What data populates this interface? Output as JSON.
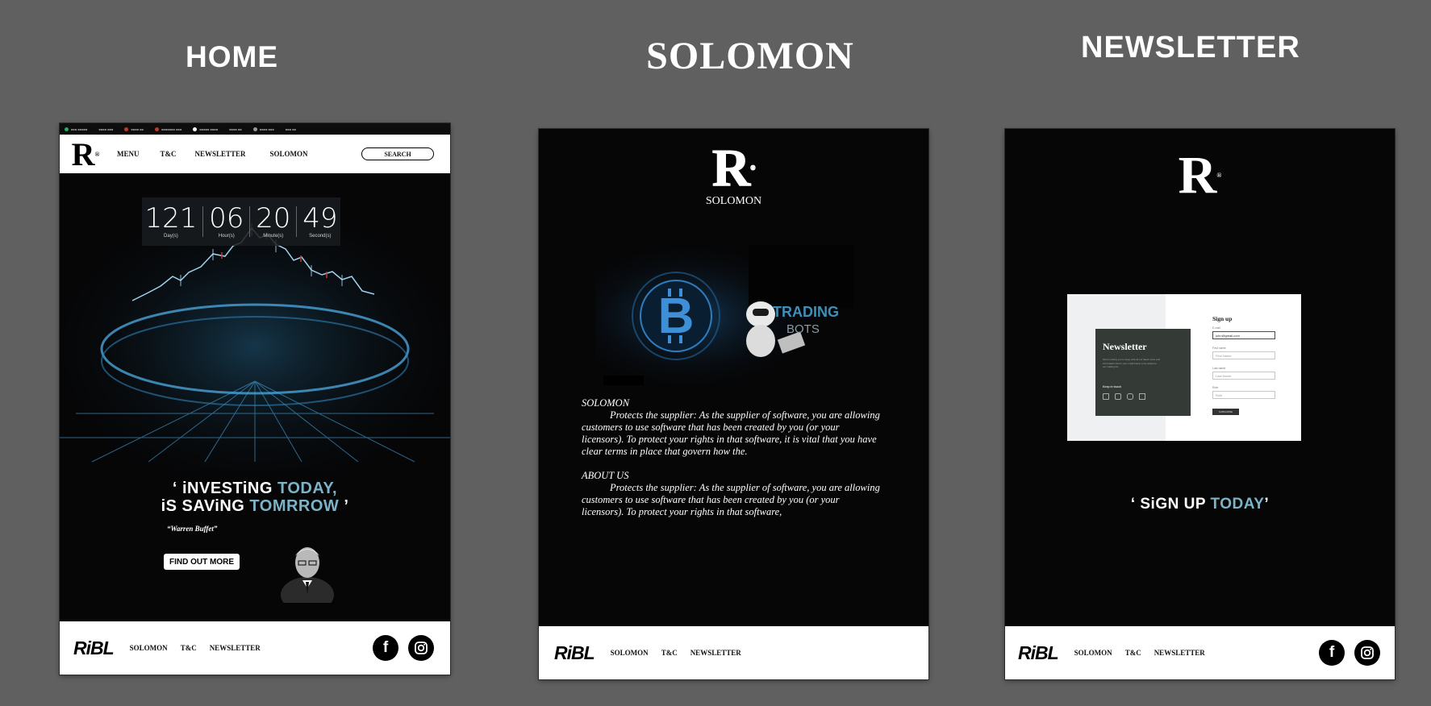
{
  "boards": [
    {
      "title": "HOME"
    },
    {
      "title": "SOLOMON"
    },
    {
      "title": "NEWSLETTER"
    }
  ],
  "home": {
    "nav": {
      "menu": "MENU",
      "tc": "T&C",
      "newsletter": "NEWSLETTER",
      "solomon": "SOLOMON",
      "search": "SEARCH"
    },
    "countdown": {
      "days": "121",
      "days_label": "Day(s)",
      "hours": "06",
      "hours_label": "Hour(s)",
      "minutes": "20",
      "minutes_label": "Minute(s)",
      "seconds": "49",
      "seconds_label": "Second(s)"
    },
    "quote": {
      "line1_open": "‘ iNVESTiNG ",
      "line1_accent": "TODAY,",
      "line2_open": "iS SAViNG ",
      "line2_accent": "TOMRROW",
      "line2_close": " ’",
      "author": "“Warren Buffet”"
    },
    "cta": "FIND OUT MORE"
  },
  "solomon": {
    "brand_word": "SOLOMON",
    "banner_text1": "TRADING",
    "banner_text2": "BOTS",
    "section1_title": "SOLOMON",
    "section1_body": "Protects the supplier: As the supplier of software, you are allowing customers to use software that has been created by you (or your licensors). To protect your rights in that software, it is vital that you have clear terms in place that govern how the.",
    "section2_title": "ABOUT US",
    "section2_body": "Protects the supplier: As the supplier of software, you are allowing customers to use software that has been created by you (or your licensors). To protect your rights in that software,"
  },
  "newsletter": {
    "card_title": "Newsletter",
    "card_blurb": "We're inviting you to keep with all our latest news and information! Enter your email below to be added to our mailing list.",
    "keep_in_touch": "Keep in touch",
    "signup_title": "Sign up",
    "email_label": "E-mail",
    "email_value": "john@gmail.com",
    "first_label": "First name",
    "first_placeholder": "First Name",
    "last_label": "Last name",
    "last_placeholder": "Last Name",
    "role_label": "Role",
    "role_placeholder": "Role",
    "subscribe": "SUBSCRIBE",
    "slogan_open": "‘ SiGN UP ",
    "slogan_accent": "TODAY",
    "slogan_close": "’"
  },
  "footer": {
    "brand": "RiBL",
    "solomon": "SOLOMON",
    "tc": "T&C",
    "newsletter": "NEWSLETTER",
    "facebook_icon": "facebook-icon",
    "instagram_icon": "instagram-icon"
  },
  "colors": {
    "background": "#606060",
    "frame": "#060607",
    "accent": "#7bb3c9"
  }
}
